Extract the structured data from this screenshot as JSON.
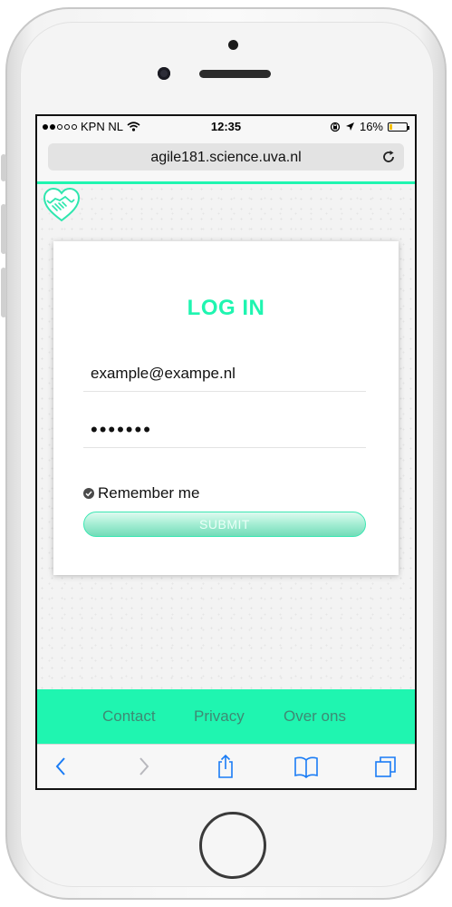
{
  "status_bar": {
    "carrier": "KPN NL",
    "time": "12:35",
    "battery_percent_label": "16%",
    "battery_level": 0.16
  },
  "browser": {
    "url": "agile181.science.uva.nl"
  },
  "login": {
    "title": "LOG IN",
    "email_value": "example@exampe.nl",
    "password_value": "•••••••",
    "remember_label": "Remember me",
    "submit_label": "SUBMIT"
  },
  "footer": {
    "links": [
      "Contact",
      "Privacy",
      "Over ons"
    ]
  },
  "toolbar": {
    "icons": [
      "back-icon",
      "forward-icon",
      "share-icon",
      "bookmarks-icon",
      "tabs-icon"
    ]
  },
  "colors": {
    "accent": "#1ff5b0",
    "ios_blue": "#1a7cf5"
  }
}
